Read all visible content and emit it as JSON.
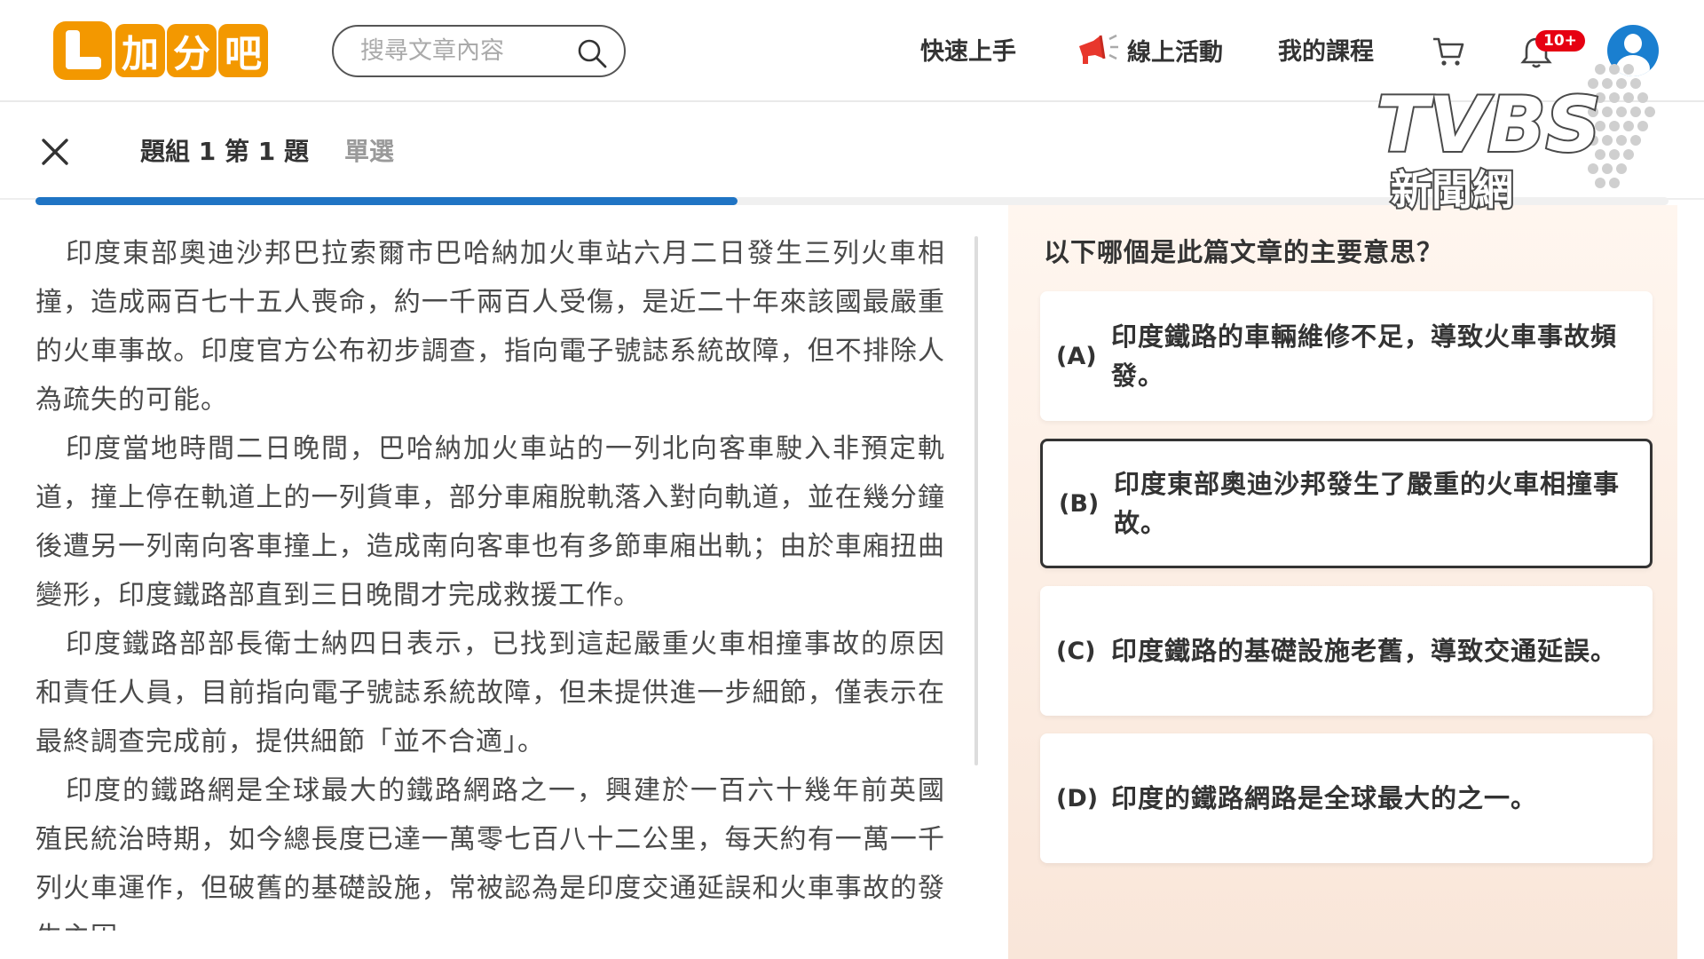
{
  "header": {
    "logo_text": [
      "加",
      "分",
      "吧"
    ],
    "search_placeholder": "搜尋文章內容",
    "nav_quick_start": "快速上手",
    "nav_online_events": "線上活動",
    "nav_my_courses": "我的課程",
    "notification_badge": "10+"
  },
  "question_header": {
    "group_label": "題組 1  第 1 題",
    "type_label": "單選",
    "progress_percent": 43
  },
  "article": {
    "paragraphs": [
      "印度東部奧迪沙邦巴拉索爾市巴哈納加火車站六月二日發生三列火車相撞，造成兩百七十五人喪命，約一千兩百人受傷，是近二十年來該國最嚴重的火車事故。印度官方公布初步調查，指向電子號誌系統故障，但不排除人為疏失的可能。",
      "印度當地時間二日晚間，巴哈納加火車站的一列北向客車駛入非預定軌道，撞上停在軌道上的一列貨車，部分車廂脫軌落入對向軌道，並在幾分鐘後遭另一列南向客車撞上，造成南向客車也有多節車廂出軌；由於車廂扭曲變形，印度鐵路部直到三日晚間才完成救援工作。",
      "印度鐵路部部長衛士納四日表示，已找到這起嚴重火車相撞事故的原因和責任人員，目前指向電子號誌系統故障，但未提供進一步細節，僅表示在最終調查完成前，提供細節「並不合適」。",
      "印度的鐵路網是全球最大的鐵路網路之一，興建於一百六十幾年前英國殖民統治時期，如今總長度已達一萬零七百八十二公里，每天約有一萬一千列火車運作，但破舊的基礎設施，常被認為是印度交通延誤和火車事故的發生主因"
    ]
  },
  "question": {
    "prompt": "以下哪個是此篇文章的主要意思？",
    "options": [
      {
        "letter": "(A)",
        "text": "印度鐵路的車輛維修不足，導致火車事故頻發。"
      },
      {
        "letter": "(B)",
        "text": "印度東部奧迪沙邦發生了嚴重的火車相撞事故。"
      },
      {
        "letter": "(C)",
        "text": "印度鐵路的基礎設施老舊，導致交通延誤。"
      },
      {
        "letter": "(D)",
        "text": "印度的鐵路網路是全球最大的之一。"
      }
    ],
    "selected_option": "(B)"
  },
  "watermark": {
    "brand": "TVBS",
    "subtitle": "新聞網"
  },
  "colors": {
    "brand_orange": "#f39800",
    "progress_blue": "#1f74c4",
    "badge_red": "#e60012",
    "avatar_blue": "#1a7fd0"
  }
}
